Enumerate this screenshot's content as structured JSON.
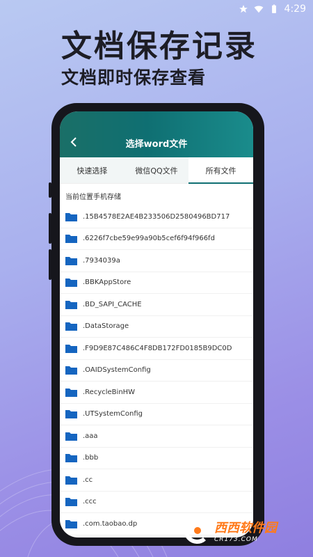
{
  "status_bar": {
    "time": "4:29",
    "icons": [
      "star-icon",
      "wifi-icon",
      "battery-icon"
    ]
  },
  "promo": {
    "title": "文档保存记录",
    "subtitle": "文档即时保存查看"
  },
  "app": {
    "title": "选择word文件",
    "back_icon": "chevron-left-icon",
    "tabs": [
      {
        "label": "快速选择",
        "active": false
      },
      {
        "label": "微信QQ文件",
        "active": false
      },
      {
        "label": "所有文件",
        "active": true
      }
    ],
    "path_label": "当前位置手机存储",
    "files": [
      ".15B4578E2AE4B233506D2580496BD717",
      ".6226f7cbe59e99a90b5cef6f94f966fd",
      ".7934039a",
      ".BBKAppStore",
      ".BD_SAPI_CACHE",
      ".DataStorage",
      ".F9D9E87C486C4F8DB172FD0185B9DC0D",
      ".OAIDSystemConfig",
      ".RecycleBinHW",
      ".UTSystemConfig",
      ".aaa",
      ".bbb",
      ".cc",
      ".ccc",
      ".com.taobao.dp"
    ]
  },
  "watermark": {
    "main": "西西软件园",
    "sub": "CR173.COM"
  },
  "colors": {
    "header": "#0f6f72",
    "folder": "#1565c0",
    "background": "#a9b0ee"
  }
}
